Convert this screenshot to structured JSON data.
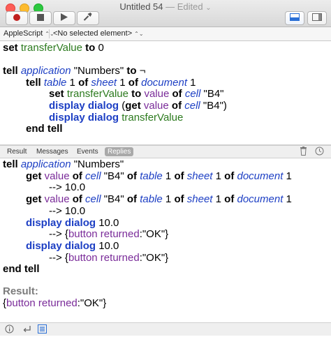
{
  "window": {
    "title": "Untitled 54",
    "separator": "—",
    "state": "Edited",
    "chevron": "⌄",
    "traffic_colors": [
      "#fd5d57",
      "#fdbb2e",
      "#2cc840"
    ]
  },
  "toolbar": {
    "buttons": [
      {
        "name": "record-icon"
      },
      {
        "name": "stop-icon"
      },
      {
        "name": "run-icon"
      },
      {
        "name": "compile-icon"
      }
    ],
    "view_toggle": "show-bottom-pane-icon",
    "sidebar_toggle": "show-sidebar-icon"
  },
  "navbar": {
    "language": "AppleScript",
    "element": "<No selected element>"
  },
  "editor_lines": [
    {
      "indent": 0,
      "tokens": [
        [
          "kw",
          "set "
        ],
        [
          "var",
          "transferValue"
        ],
        [
          "kw",
          " to "
        ],
        [
          "plain",
          "0"
        ]
      ]
    },
    {
      "indent": 0,
      "tokens": []
    },
    {
      "indent": 0,
      "tokens": [
        [
          "kw",
          "tell "
        ],
        [
          "cls",
          "application"
        ],
        [
          "plain",
          " \"Numbers\" "
        ],
        [
          "kw",
          "to"
        ],
        [
          "plain",
          " ¬"
        ]
      ]
    },
    {
      "indent": 1,
      "tokens": [
        [
          "kw",
          "tell "
        ],
        [
          "cls",
          "table"
        ],
        [
          "plain",
          " 1 "
        ],
        [
          "kw",
          "of "
        ],
        [
          "cls",
          "sheet"
        ],
        [
          "plain",
          " 1 "
        ],
        [
          "kw",
          "of "
        ],
        [
          "cls",
          "document"
        ],
        [
          "plain",
          " 1"
        ]
      ]
    },
    {
      "indent": 2,
      "tokens": [
        [
          "kw",
          "set "
        ],
        [
          "var",
          "transferValue"
        ],
        [
          "kw",
          " to "
        ],
        [
          "prop",
          "value"
        ],
        [
          "kw",
          " of "
        ],
        [
          "cls",
          "cell"
        ],
        [
          "plain",
          " \"B4\""
        ]
      ]
    },
    {
      "indent": 2,
      "tokens": [
        [
          "cmd",
          "display dialog"
        ],
        [
          "plain",
          " ("
        ],
        [
          "kw",
          "get "
        ],
        [
          "prop",
          "value"
        ],
        [
          "kw",
          " of "
        ],
        [
          "cls",
          "cell"
        ],
        [
          "plain",
          " \"B4\")"
        ]
      ]
    },
    {
      "indent": 2,
      "tokens": [
        [
          "cmd",
          "display dialog"
        ],
        [
          "plain",
          " "
        ],
        [
          "var",
          "transferValue"
        ]
      ]
    },
    {
      "indent": 1,
      "tokens": [
        [
          "kw",
          "end tell"
        ]
      ]
    }
  ],
  "log_tabs": [
    {
      "label": "Result",
      "active": false
    },
    {
      "label": "Messages",
      "active": false
    },
    {
      "label": "Events",
      "active": false
    },
    {
      "label": "Replies",
      "active": true
    }
  ],
  "log_lines": [
    {
      "indent": 0,
      "tokens": [
        [
          "kw",
          "tell "
        ],
        [
          "cls",
          "application"
        ],
        [
          "plain",
          " \"Numbers\""
        ]
      ]
    },
    {
      "indent": 1,
      "tokens": [
        [
          "kw",
          "get "
        ],
        [
          "prop",
          "value"
        ],
        [
          "kw",
          " of "
        ],
        [
          "cls",
          "cell"
        ],
        [
          "plain",
          " \"B4\" "
        ],
        [
          "kw",
          "of "
        ],
        [
          "cls",
          "table"
        ],
        [
          "plain",
          " 1 "
        ],
        [
          "kw",
          "of "
        ],
        [
          "cls",
          "sheet"
        ],
        [
          "plain",
          " 1 "
        ],
        [
          "kw",
          "of "
        ],
        [
          "cls",
          "document"
        ],
        [
          "plain",
          " 1"
        ]
      ]
    },
    {
      "indent": 2,
      "tokens": [
        [
          "plain",
          "--> 10.0"
        ]
      ]
    },
    {
      "indent": 1,
      "tokens": [
        [
          "kw",
          "get "
        ],
        [
          "prop",
          "value"
        ],
        [
          "kw",
          " of "
        ],
        [
          "cls",
          "cell"
        ],
        [
          "plain",
          " \"B4\" "
        ],
        [
          "kw",
          "of "
        ],
        [
          "cls",
          "table"
        ],
        [
          "plain",
          " 1 "
        ],
        [
          "kw",
          "of "
        ],
        [
          "cls",
          "sheet"
        ],
        [
          "plain",
          " 1 "
        ],
        [
          "kw",
          "of "
        ],
        [
          "cls",
          "document"
        ],
        [
          "plain",
          " 1"
        ]
      ]
    },
    {
      "indent": 2,
      "tokens": [
        [
          "plain",
          "--> 10.0"
        ]
      ]
    },
    {
      "indent": 1,
      "tokens": [
        [
          "cmd",
          "display dialog"
        ],
        [
          "plain",
          " 10.0"
        ]
      ]
    },
    {
      "indent": 2,
      "tokens": [
        [
          "plain",
          "--> {"
        ],
        [
          "prop",
          "button returned"
        ],
        [
          "plain",
          ":\"OK\"}"
        ]
      ]
    },
    {
      "indent": 1,
      "tokens": [
        [
          "cmd",
          "display dialog"
        ],
        [
          "plain",
          " 10.0"
        ]
      ]
    },
    {
      "indent": 2,
      "tokens": [
        [
          "plain",
          "--> {"
        ],
        [
          "prop",
          "button returned"
        ],
        [
          "plain",
          ":\"OK\"}"
        ]
      ]
    },
    {
      "indent": 0,
      "tokens": [
        [
          "kw",
          "end tell"
        ]
      ]
    }
  ],
  "result": {
    "label": "Result:",
    "tokens": [
      [
        "plain",
        "{"
      ],
      [
        "prop",
        "button returned"
      ],
      [
        "plain",
        ":\"OK\"}"
      ]
    ]
  },
  "statusbar": {
    "icons": [
      "info-icon",
      "return-icon",
      "list-icon"
    ]
  }
}
